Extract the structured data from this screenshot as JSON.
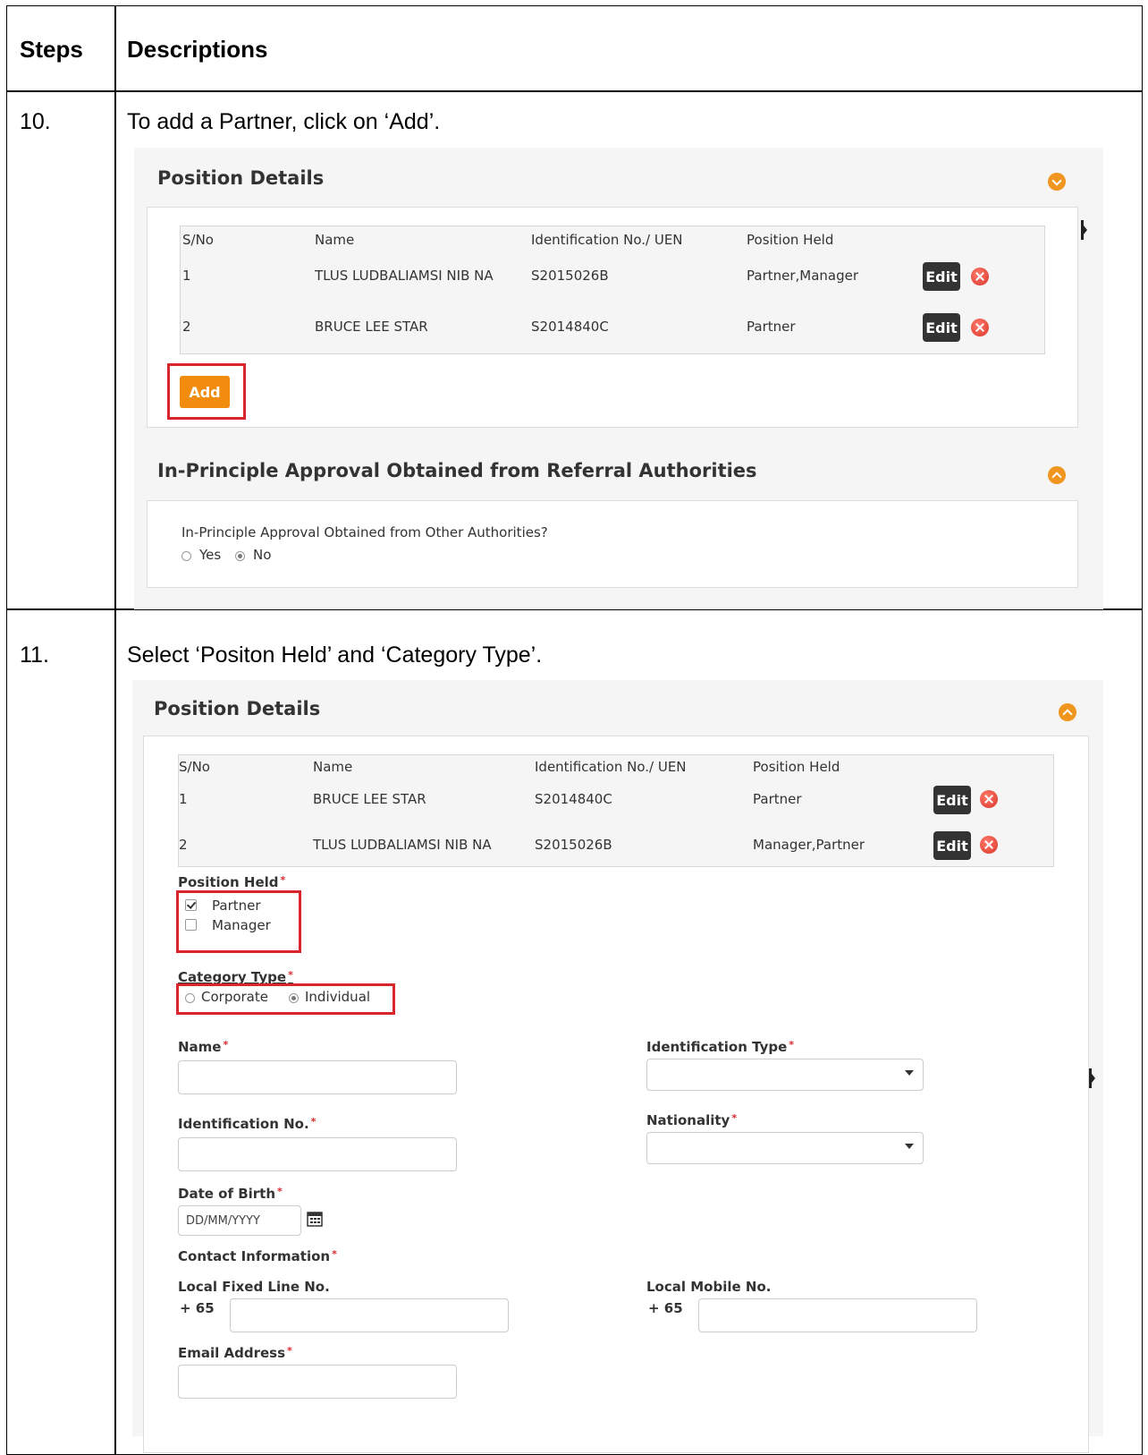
{
  "table": {
    "col_steps": "Steps",
    "col_desc": "Descriptions",
    "rows": [
      {
        "num": "10.",
        "text": "To add a Partner, click on ‘Add’."
      },
      {
        "num": "11.",
        "text": "Select ‘Positon Held’ and ‘Category Type’."
      }
    ]
  },
  "shot1": {
    "section_title": "Position Details",
    "columns": [
      "S/No",
      "Name",
      "Identification No./ UEN",
      "Position Held"
    ],
    "rows": [
      {
        "sno": "1",
        "name": "TLUS LUDBALIAMSI NIB NA",
        "id": "S2015026B",
        "position": "Partner,Manager"
      },
      {
        "sno": "2",
        "name": "BRUCE LEE STAR",
        "id": "S2014840C",
        "position": "Partner"
      }
    ],
    "edit_label": "Edit",
    "add_label": "Add",
    "approval_title": "In-Principle Approval Obtained from Referral Authorities",
    "approval_question": "In-Principle Approval Obtained from Other Authorities?",
    "yes_label": "Yes",
    "no_label": "No"
  },
  "shot2": {
    "section_title": "Position Details",
    "columns": [
      "S/No",
      "Name",
      "Identification No./ UEN",
      "Position Held"
    ],
    "rows": [
      {
        "sno": "1",
        "name": "BRUCE LEE STAR",
        "id": "S2014840C",
        "position": "Partner"
      },
      {
        "sno": "2",
        "name": "TLUS LUDBALIAMSI NIB NA",
        "id": "S2015026B",
        "position": "Manager,Partner"
      }
    ],
    "edit_label": "Edit",
    "position_held_label": "Position Held",
    "partner_label": "Partner",
    "manager_label": "Manager",
    "category_type_label": "Category Type",
    "corporate_label": "Corporate",
    "individual_label": "Individual",
    "name_label": "Name",
    "id_type_label": "Identification Type",
    "id_no_label": "Identification No.",
    "nationality_label": "Nationality",
    "dob_label": "Date of Birth",
    "dob_placeholder": "DD/MM/YYYY",
    "contact_label": "Contact Information",
    "fixed_line_label": "Local Fixed Line No.",
    "mobile_label": "Local Mobile No.",
    "country_code": "+ 65",
    "email_label": "Email Address",
    "required_mark": "*"
  }
}
